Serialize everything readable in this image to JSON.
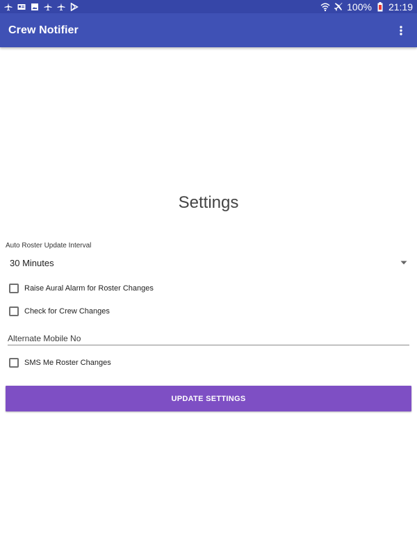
{
  "status_bar": {
    "left_icons": [
      "plane-icon",
      "id-card-icon",
      "image-icon",
      "plane-icon",
      "plane-icon",
      "play-store-icon"
    ],
    "battery": "100%",
    "time": "21:19"
  },
  "app_bar": {
    "title": "Crew Notifier"
  },
  "settings": {
    "title": "Settings",
    "interval_label": "Auto Roster Update Interval",
    "interval_value": "30 Minutes",
    "aural_alarm_label": "Raise Aural Alarm for Roster Changes",
    "crew_changes_label": "Check for Crew Changes",
    "mobile_placeholder": "Alternate Mobile No",
    "sms_label": "SMS Me Roster Changes",
    "update_button": "UPDATE SETTINGS"
  },
  "colors": {
    "status_bar": "#3646a8",
    "app_bar": "#3f51b5",
    "button": "#7e4fc4"
  }
}
